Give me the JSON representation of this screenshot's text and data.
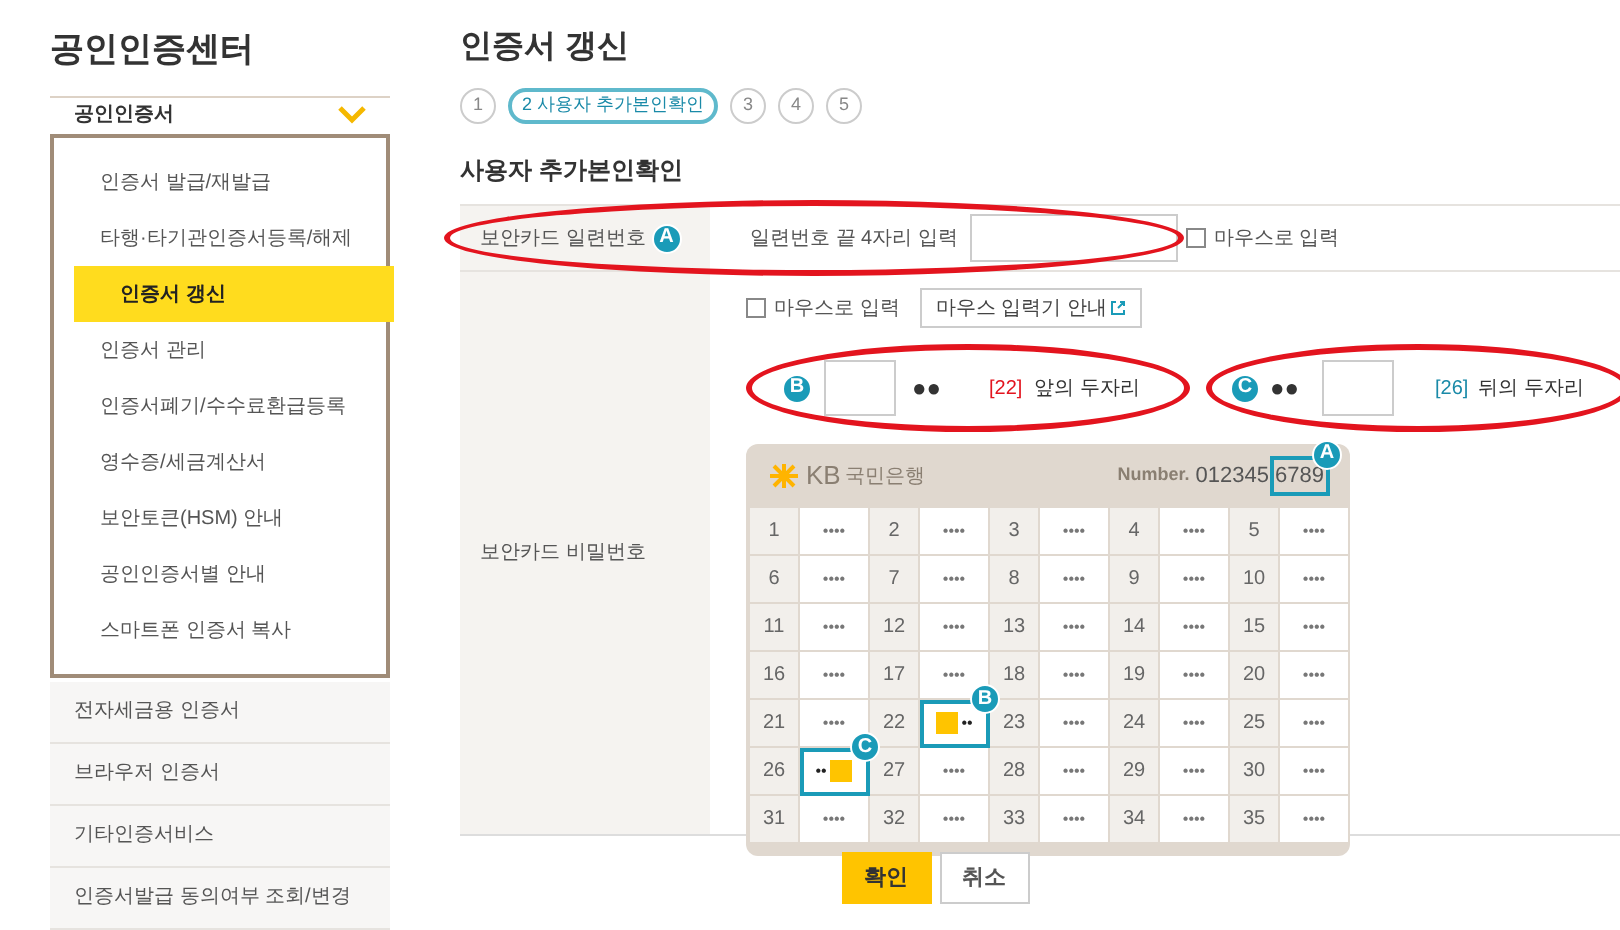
{
  "sidebar": {
    "title": "공인인증센터",
    "group": {
      "label": "공인인증서",
      "expanded": true,
      "items": [
        {
          "label": "인증서 발급/재발급",
          "selected": false
        },
        {
          "label": "타행·타기관인증서등록/해제",
          "selected": false
        },
        {
          "label": "인증서 갱신",
          "selected": true
        },
        {
          "label": "인증서 관리",
          "selected": false
        },
        {
          "label": "인증서폐기/수수료환급등록",
          "selected": false
        },
        {
          "label": "영수증/세금계산서",
          "selected": false
        },
        {
          "label": "보안토큰(HSM) 안내",
          "selected": false
        },
        {
          "label": "공인인증서별 안내",
          "selected": false
        },
        {
          "label": "스마트폰 인증서 복사",
          "selected": false
        }
      ]
    },
    "items": [
      "전자세금용 인증서",
      "브라우저 인증서",
      "기타인증서비스",
      "인증서발급 동의여부 조회/변경"
    ]
  },
  "page_title": "인증서 갱신",
  "steps": [
    {
      "label": "1",
      "selected": false
    },
    {
      "label": "2 사용자 추가본인확인",
      "selected": true
    },
    {
      "label": "3",
      "selected": false
    },
    {
      "label": "4",
      "selected": false
    },
    {
      "label": "5",
      "selected": false
    }
  ],
  "section_title": "사용자 추가본인확인",
  "serial_row": {
    "label": "보안카드 일련번호",
    "badge": "A",
    "prompt": "일련번호 끝 4자리 입력",
    "mouse_input": {
      "label": "마우스로 입력",
      "checked": false
    }
  },
  "password_row": {
    "label": "보안카드 비밀번호",
    "mouse_input": {
      "label": "마우스로 입력",
      "checked": false
    },
    "guide_button": "마우스 입력기 안내",
    "first": {
      "badge": "B",
      "dots": "●●",
      "number": "[22]",
      "label": "앞의 두자리"
    },
    "last": {
      "badge": "C",
      "dots": "●●",
      "number": "[26]",
      "label": "뒤의 두자리"
    }
  },
  "card": {
    "bank_code": "KB",
    "bank_name": "국민은행",
    "number_label": "Number.",
    "number_start": "012345",
    "number_end": "6789",
    "number_badge": "A",
    "cells": [
      {
        "number": "1",
        "value": "••••",
        "kind": "masked"
      },
      {
        "number": "2",
        "value": "••••",
        "kind": "masked"
      },
      {
        "number": "3",
        "value": "••••",
        "kind": "masked"
      },
      {
        "number": "4",
        "value": "••••",
        "kind": "masked"
      },
      {
        "number": "5",
        "value": "••••",
        "kind": "masked"
      },
      {
        "number": "6",
        "value": "••••",
        "kind": "masked"
      },
      {
        "number": "7",
        "value": "••••",
        "kind": "masked"
      },
      {
        "number": "8",
        "value": "••••",
        "kind": "masked"
      },
      {
        "number": "9",
        "value": "••••",
        "kind": "masked"
      },
      {
        "number": "10",
        "value": "••••",
        "kind": "masked"
      },
      {
        "number": "11",
        "value": "••••",
        "kind": "masked"
      },
      {
        "number": "12",
        "value": "••••",
        "kind": "masked"
      },
      {
        "number": "13",
        "value": "••••",
        "kind": "masked"
      },
      {
        "number": "14",
        "value": "••••",
        "kind": "masked"
      },
      {
        "number": "15",
        "value": "••••",
        "kind": "masked"
      },
      {
        "number": "16",
        "value": "••••",
        "kind": "masked"
      },
      {
        "number": "17",
        "value": "••••",
        "kind": "masked"
      },
      {
        "number": "18",
        "value": "••••",
        "kind": "masked"
      },
      {
        "number": "19",
        "value": "••••",
        "kind": "masked"
      },
      {
        "number": "20",
        "value": "••••",
        "kind": "masked"
      },
      {
        "number": "21",
        "value": "••••",
        "kind": "masked"
      },
      {
        "number": "22",
        "value": "••",
        "kind": "front",
        "badge": "B"
      },
      {
        "number": "23",
        "value": "••••",
        "kind": "masked"
      },
      {
        "number": "24",
        "value": "••••",
        "kind": "masked"
      },
      {
        "number": "25",
        "value": "••••",
        "kind": "masked"
      },
      {
        "number": "26",
        "value": "••",
        "kind": "back",
        "badge": "C"
      },
      {
        "number": "27",
        "value": "••••",
        "kind": "masked"
      },
      {
        "number": "28",
        "value": "••••",
        "kind": "masked"
      },
      {
        "number": "29",
        "value": "••••",
        "kind": "masked"
      },
      {
        "number": "30",
        "value": "••••",
        "kind": "masked"
      },
      {
        "number": "31",
        "value": "••••",
        "kind": "masked"
      },
      {
        "number": "32",
        "value": "••••",
        "kind": "masked"
      },
      {
        "number": "33",
        "value": "••••",
        "kind": "masked"
      },
      {
        "number": "34",
        "value": "••••",
        "kind": "masked"
      },
      {
        "number": "35",
        "value": "••••",
        "kind": "masked"
      }
    ]
  },
  "buttons": [
    {
      "label": "확인",
      "kind": "primary"
    },
    {
      "label": "취소",
      "kind": "secondary"
    }
  ]
}
